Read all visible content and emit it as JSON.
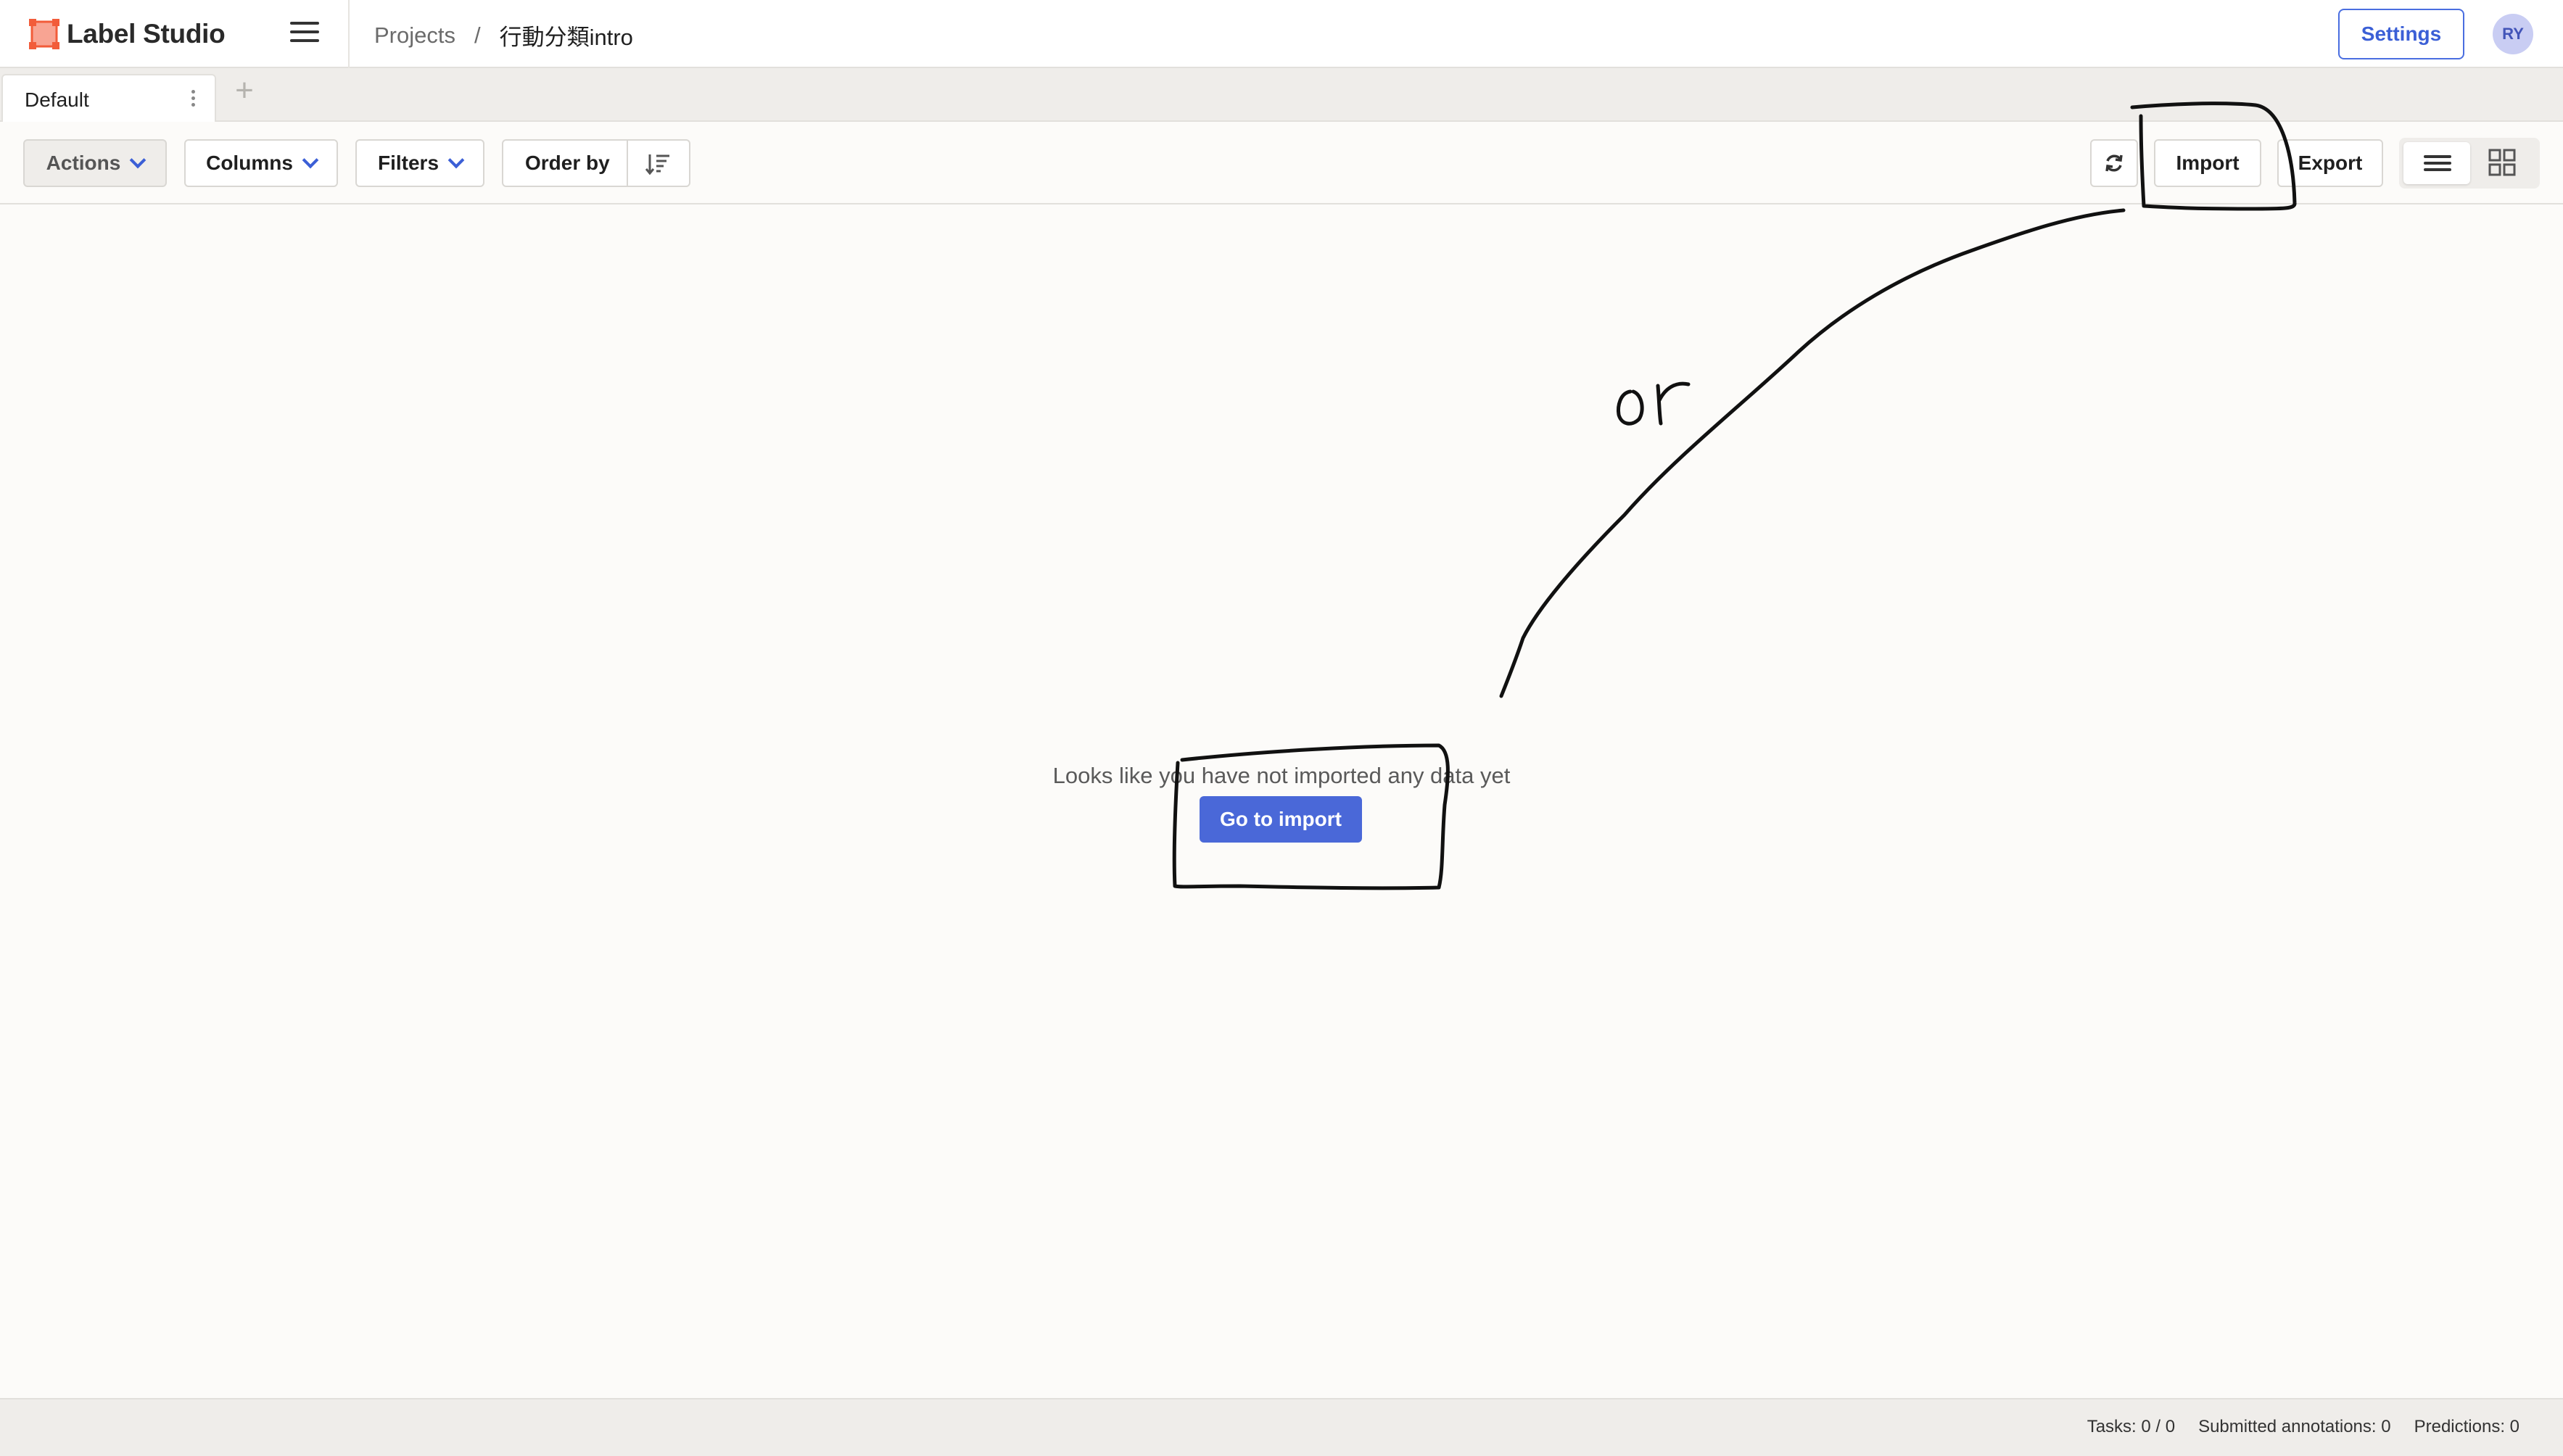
{
  "header": {
    "app_name": "Label Studio",
    "breadcrumb": {
      "projects": "Projects",
      "separator": "/",
      "current_project": "行動分類intro"
    },
    "settings_label": "Settings",
    "avatar_initials": "RY",
    "accent_color": "#4a6ee0",
    "logo_color": "#f25c3a"
  },
  "tabs": {
    "items": [
      {
        "label": "Default",
        "active": true
      }
    ],
    "add_icon": "plus-icon"
  },
  "toolbar": {
    "actions_label": "Actions",
    "columns_label": "Columns",
    "filters_label": "Filters",
    "order_by_label": "Order by",
    "refresh_icon": "refresh-icon",
    "import_label": "Import",
    "export_label": "Export",
    "view_modes": [
      {
        "icon": "list-view-icon",
        "active": true
      },
      {
        "icon": "grid-view-icon",
        "active": false
      }
    ]
  },
  "empty_state": {
    "message": "Looks like you have not imported any data yet",
    "button_label": "Go to import",
    "button_color": "#4a68d8"
  },
  "annotation": {
    "handwritten_text": "or"
  },
  "footer": {
    "tasks": "Tasks: 0 / 0",
    "submitted_annotations": "Submitted annotations: 0",
    "predictions": "Predictions: 0"
  }
}
